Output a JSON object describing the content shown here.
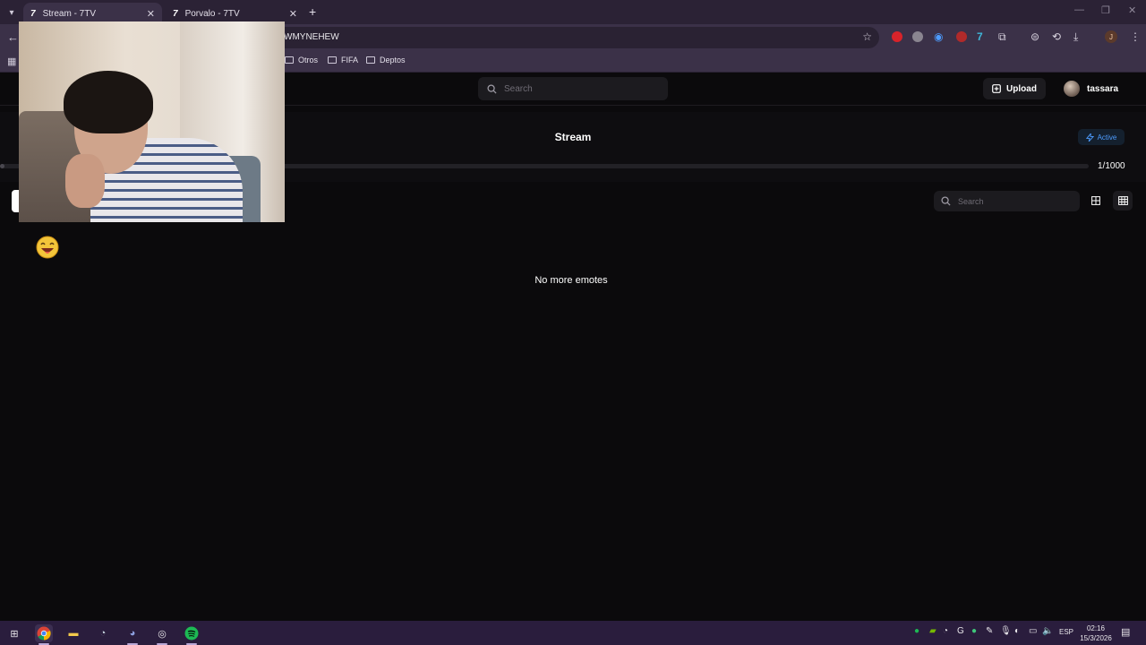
{
  "browser": {
    "tabs": [
      {
        "title": "Stream - 7TV",
        "active": true
      },
      {
        "title": "Porvalo - 7TV",
        "active": false
      }
    ],
    "new_tab_icon": "plus-icon",
    "url": "WMYNEHEW",
    "bookmarks": [
      "Otros",
      "FIFA",
      "Deptos"
    ],
    "profile_initial": "J"
  },
  "site": {
    "search_placeholder": "Search",
    "upload_label": "Upload",
    "username": "tassara"
  },
  "emote_set": {
    "title": "Stream",
    "status": "Active",
    "capacity_text": "1/1000",
    "usage_fraction": 0.001,
    "filter_placeholder": "Search",
    "empty_message": "No more emotes"
  },
  "taskbar": {
    "language": "ESP",
    "time": "02:16",
    "date": "15/3/2026"
  }
}
